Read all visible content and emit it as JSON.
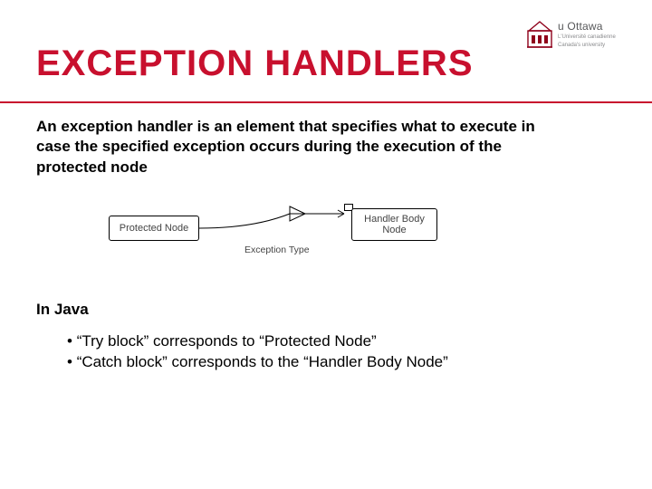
{
  "logo": {
    "main": "u Ottawa",
    "sub1": "L'Université canadienne",
    "sub2": "Canada's university"
  },
  "title": "EXCEPTION HANDLERS",
  "body": "An exception handler is an element that specifies what to execute in case the specified exception occurs during the execution of the protected node",
  "diagram": {
    "left_node": "Protected Node",
    "right_node": "Handler Body Node",
    "exception_label": "Exception Type"
  },
  "subhead": "In Java",
  "bullets": [
    "“Try block” corresponds to “Protected Node”",
    "“Catch block” corresponds to the “Handler Body Node”"
  ]
}
